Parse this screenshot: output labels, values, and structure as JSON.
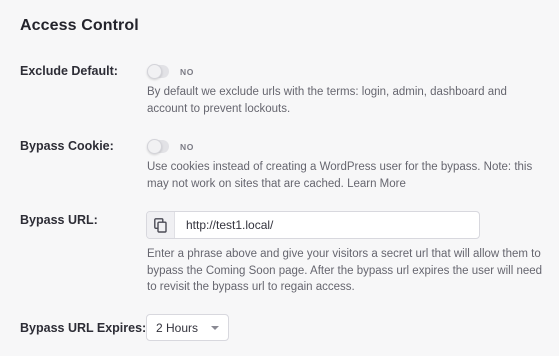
{
  "section": {
    "title": "Access Control"
  },
  "exclude_default": {
    "label": "Exclude Default:",
    "toggle_state": "NO",
    "help": "By default we exclude urls with the terms: login, admin, dashboard and account to prevent lockouts."
  },
  "bypass_cookie": {
    "label": "Bypass Cookie:",
    "toggle_state": "NO",
    "help": "Use cookies instead of creating a WordPress user for the bypass. Note: this may not work on sites that are cached. Learn More"
  },
  "bypass_url": {
    "label": "Bypass URL:",
    "value": "http://test1.local/",
    "copy_icon": "copy-icon",
    "help": "Enter a phrase above and give your visitors a secret url that will allow them to bypass the Coming Soon page. After the bypass url expires the user will need to revisit the bypass url to regain access."
  },
  "bypass_url_expires": {
    "label": "Bypass URL Expires:",
    "selected": "2 Hours"
  },
  "colors": {
    "background": "#f7f7f8",
    "toggle_off": "#e2e2e6",
    "text_muted": "#66666f"
  }
}
